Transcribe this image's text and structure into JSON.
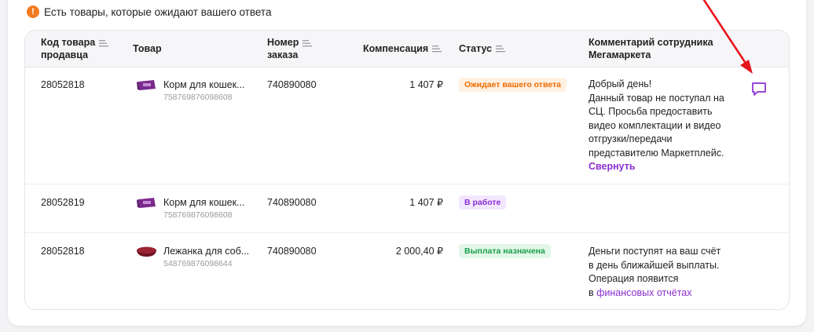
{
  "notice": {
    "text": "Есть товары, которые ожидают вашего ответа"
  },
  "headers": {
    "seller_code": [
      "Код товара",
      "продавца"
    ],
    "product": "Товар",
    "order_number": [
      "Номер",
      "заказа"
    ],
    "compensation": "Компенсация",
    "status": "Статус",
    "comment": [
      "Комментарий сотрудника",
      "Мегамаркета"
    ]
  },
  "rows": [
    {
      "seller_code": "28052818",
      "product_name": "Корм для кошек...",
      "product_sku": "758769876098608",
      "order_number": "740890080",
      "compensation": "1 407 ₽",
      "status": "Ожидает вашего ответа",
      "comment_lines": [
        "Добрый день!",
        "Данный товар не поступал на",
        "СЦ. Просьба предоставить",
        "видео комплектации и видео",
        "отгрузки/передачи",
        "представителю Маркетплейс."
      ],
      "comment_toggle": "Свернуть"
    },
    {
      "seller_code": "28052819",
      "product_name": "Корм для кошек...",
      "product_sku": "758769876098608",
      "order_number": "740890080",
      "compensation": "1 407 ₽",
      "status": "В работе"
    },
    {
      "seller_code": "28052818",
      "product_name": "Лежанка для соб...",
      "product_sku": "548769876098644",
      "order_number": "740890080",
      "compensation": "2 000,40 ₽",
      "status": "Выплата назначена",
      "comment_lines": [
        "Деньги поступят на ваш счёт",
        "в день ближайшей выплаты.",
        "Операция появится"
      ],
      "comment_prefix": "в ",
      "comment_link": "финансовых отчётах"
    }
  ],
  "colors": {
    "accent": "#8a2fd1",
    "warning": "#f47b20",
    "arrow": "#e8141c"
  },
  "icons": {
    "notice": "warning-icon",
    "sort": "sort-icon",
    "chat": "chat-icon"
  }
}
